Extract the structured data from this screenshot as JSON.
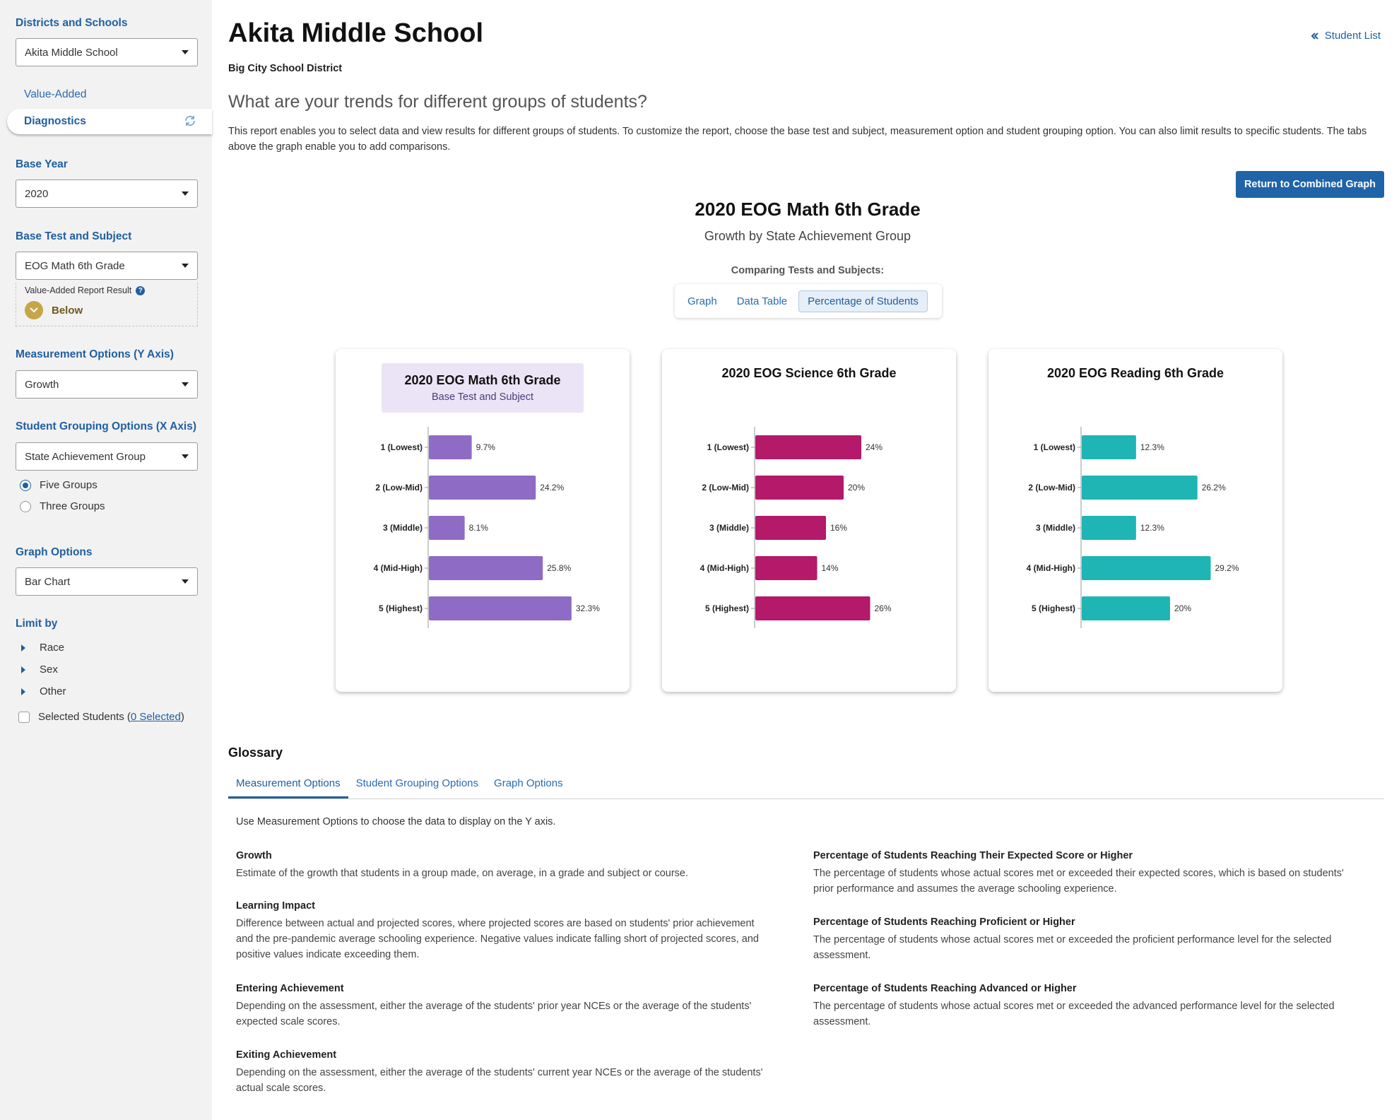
{
  "sidebar": {
    "districts_label": "Districts and Schools",
    "school_select": "Akita Middle School",
    "nav": {
      "value_added": "Value-Added",
      "diagnostics": "Diagnostics"
    },
    "base_year_label": "Base Year",
    "base_year": "2020",
    "base_test_label": "Base Test and Subject",
    "base_test": "EOG Math 6th Grade",
    "result_label": "Value-Added Report Result",
    "result_value": "Below",
    "measurement_label": "Measurement Options (Y Axis)",
    "measurement": "Growth",
    "grouping_label": "Student Grouping Options (X Axis)",
    "grouping": "State Achievement Group",
    "radio_five": "Five Groups",
    "radio_three": "Three Groups",
    "graph_options_label": "Graph Options",
    "graph_option": "Bar Chart",
    "limit_label": "Limit by",
    "limit_items": [
      "Race",
      "Sex",
      "Other"
    ],
    "selected_students": "Selected Students (",
    "selected_link": "0 Selected",
    "selected_close": ")"
  },
  "header": {
    "title": "Akita Middle School",
    "district": "Big City School District",
    "student_list": "Student List",
    "question": "What are your trends for different groups of students?",
    "intro": "This report enables you to select data and view results for different groups of students. To customize the report, choose the base test and subject, measurement option and student grouping option. You can also limit results to specific students. The tabs above the graph enable you to add comparisons.",
    "return_button": "Return to Combined Graph"
  },
  "report": {
    "title": "2020 EOG Math 6th Grade",
    "subtitle": "Growth by State Achievement Group",
    "comparing": "Comparing Tests and Subjects:",
    "tabs": [
      "Graph",
      "Data Table",
      "Percentage of Students"
    ],
    "base_label": "Base Test and Subject"
  },
  "colors": {
    "math": "#8e6bc4",
    "science": "#b4196a",
    "reading": "#1fb5b5",
    "accent": "#1f63a8"
  },
  "chart_data": [
    {
      "type": "bar",
      "orientation": "horizontal",
      "title": "2020 EOG Math 6th Grade",
      "categories": [
        "1 (Lowest)",
        "2 (Low-Mid)",
        "3 (Middle)",
        "4 (Mid-High)",
        "5 (Highest)"
      ],
      "values": [
        9.7,
        24.2,
        8.1,
        25.8,
        32.3
      ],
      "labels": [
        "9.7%",
        "24.2%",
        "8.1%",
        "25.8%",
        "32.3%"
      ],
      "color": "#8e6bc4"
    },
    {
      "type": "bar",
      "orientation": "horizontal",
      "title": "2020 EOG Science 6th Grade",
      "categories": [
        "1 (Lowest)",
        "2 (Low-Mid)",
        "3 (Middle)",
        "4 (Mid-High)",
        "5 (Highest)"
      ],
      "values": [
        24,
        20,
        16,
        14,
        26
      ],
      "labels": [
        "24%",
        "20%",
        "16%",
        "14%",
        "26%"
      ],
      "color": "#b4196a"
    },
    {
      "type": "bar",
      "orientation": "horizontal",
      "title": "2020 EOG Reading 6th Grade",
      "categories": [
        "1 (Lowest)",
        "2 (Low-Mid)",
        "3 (Middle)",
        "4 (Mid-High)",
        "5 (Highest)"
      ],
      "values": [
        12.3,
        26.2,
        12.3,
        29.2,
        20
      ],
      "labels": [
        "12.3%",
        "26.2%",
        "12.3%",
        "29.2%",
        "20%"
      ],
      "color": "#1fb5b5"
    }
  ],
  "glossary": {
    "title": "Glossary",
    "tabs": [
      "Measurement Options",
      "Student Grouping Options",
      "Graph Options"
    ],
    "intro": "Use Measurement Options to choose the data to display on the Y axis.",
    "left": [
      {
        "term": "Growth",
        "def": "Estimate of the growth that students in a group made, on average, in a grade and subject or course."
      },
      {
        "term": "Learning Impact",
        "def": "Difference between actual and projected scores, where projected scores are based on students' prior achievement and the pre-pandemic average schooling experience. Negative values indicate falling short of projected scores, and positive values indicate exceeding them."
      },
      {
        "term": "Entering Achievement",
        "def": "Depending on the assessment, either the average of the students' prior year NCEs or the average of the students' expected scale scores."
      },
      {
        "term": "Exiting Achievement",
        "def": "Depending on the assessment, either the average of the students' current year NCEs or the average of the students' actual scale scores."
      }
    ],
    "right": [
      {
        "term": "Percentage of Students Reaching Their Expected Score or Higher",
        "def": "The percentage of students whose actual scores met or exceeded their expected scores, which is based on students' prior performance and assumes the average schooling experience."
      },
      {
        "term": "Percentage of Students Reaching Proficient or Higher",
        "def": "The percentage of students whose actual scores met or exceeded the proficient performance level for the selected assessment."
      },
      {
        "term": "Percentage of Students Reaching Advanced or Higher",
        "def": "The percentage of students whose actual scores met or exceeded the advanced performance level for the selected assessment."
      }
    ]
  }
}
